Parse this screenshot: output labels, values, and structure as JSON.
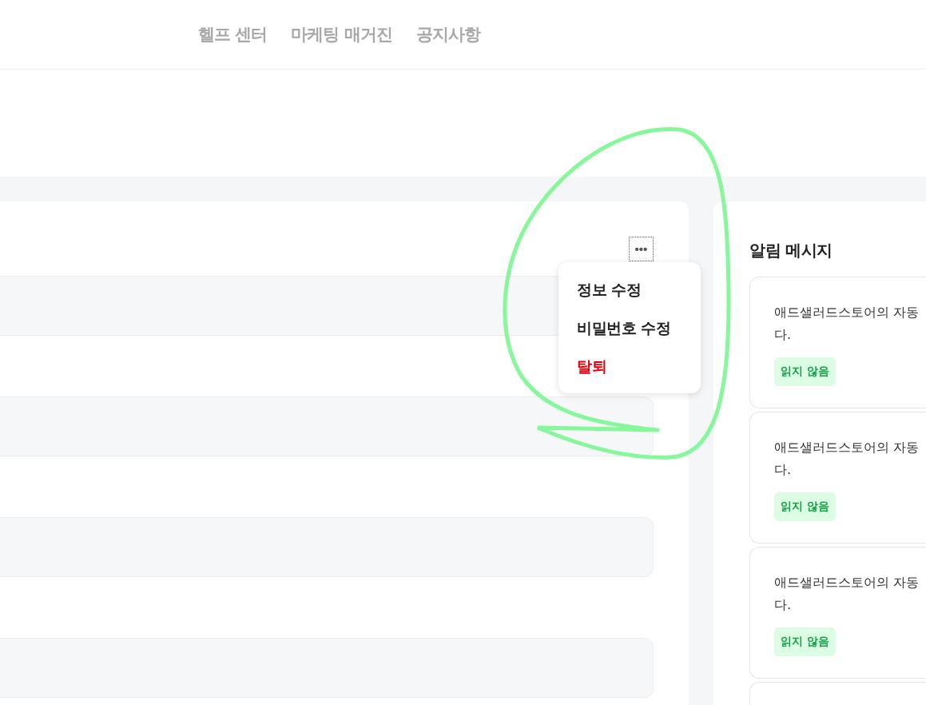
{
  "header": {
    "nav": [
      "헬프 센터",
      "마케팅 매거진",
      "공지사항"
    ]
  },
  "profile_card": {
    "more_button": "•••",
    "menu": [
      {
        "label": "정보 수정",
        "kind": "normal"
      },
      {
        "label": "비밀번호 수정",
        "kind": "normal"
      },
      {
        "label": "탈퇴",
        "kind": "danger"
      }
    ]
  },
  "notifications": {
    "title": "알림 메시지",
    "items": [
      {
        "lines": [
          "애드샐러드스토어의 자동",
          "다."
        ],
        "badge": "읽지 않음",
        "read": false
      },
      {
        "lines": [
          "애드샐러드스토어의 자동",
          "다."
        ],
        "badge": "읽지 않음",
        "read": false
      },
      {
        "lines": [
          "애드샐러드스토어의 자동",
          "다."
        ],
        "badge": "읽지 않음",
        "read": false
      }
    ]
  }
}
